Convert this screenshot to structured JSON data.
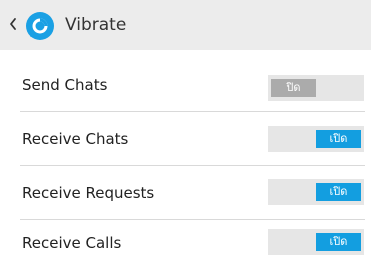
{
  "header": {
    "back_icon": "chevron-left-icon",
    "logo_icon": "app-logo-icon",
    "title": "Vibrate"
  },
  "colors": {
    "accent": "#139ee0",
    "switch_off": "#ababab",
    "header_bg": "#ececec"
  },
  "settings": [
    {
      "label": "Send Chats",
      "switch_text": "ปิด",
      "enabled": false
    },
    {
      "label": "Receive Chats",
      "switch_text": "เปิด",
      "enabled": true
    },
    {
      "label": "Receive Requests",
      "switch_text": "เปิด",
      "enabled": true
    },
    {
      "label": "Receive Calls",
      "switch_text": "เปิด",
      "enabled": true
    }
  ]
}
